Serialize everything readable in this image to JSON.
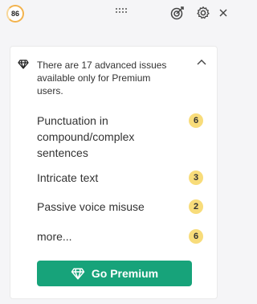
{
  "header": {
    "score": "86",
    "icons": {
      "drag": "drag-handle-icon",
      "goals": "goals-target-icon",
      "settings": "gear-icon",
      "close": "close-icon"
    }
  },
  "premium_panel": {
    "notice": "There are 17 advanced issues available only for Premium users.",
    "issues": [
      {
        "label": "Punctuation in compound/complex sentences",
        "count": "6"
      },
      {
        "label": "Intricate text",
        "count": "3"
      },
      {
        "label": "Passive voice misuse",
        "count": "2"
      },
      {
        "label": "more...",
        "count": "6"
      }
    ],
    "button_label": "Go Premium"
  },
  "colors": {
    "accent": "#17a37a",
    "badge": "#f8dc7a",
    "score_ring": "#f3b34d"
  }
}
